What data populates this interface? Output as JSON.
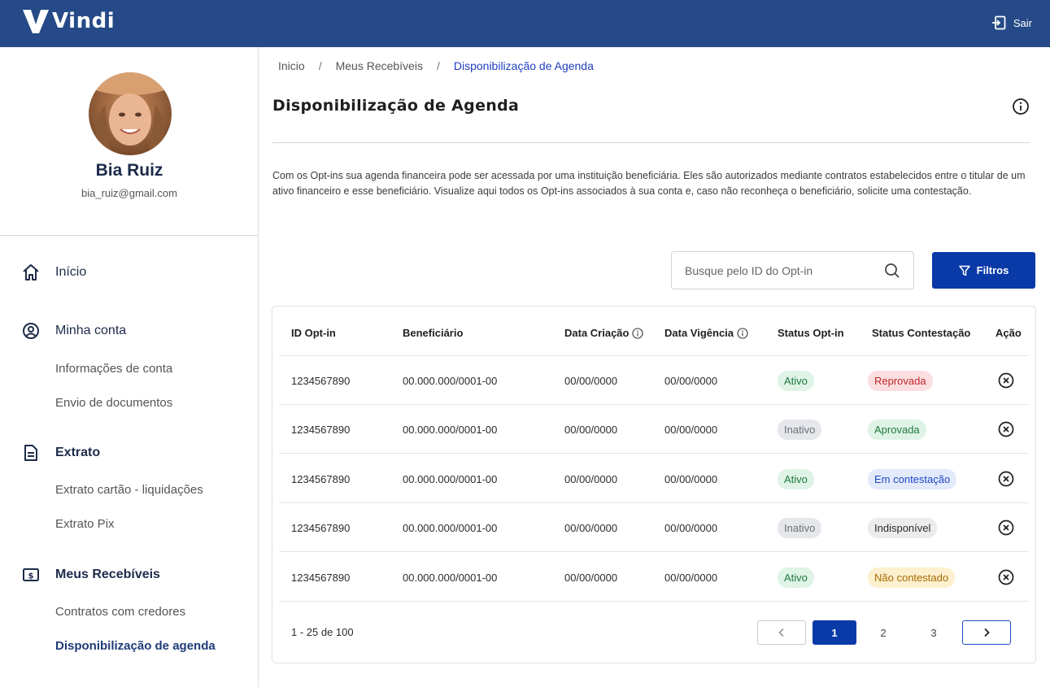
{
  "app": {
    "brand": "Vindi",
    "logout_label": "Sair"
  },
  "user": {
    "name": "Bia Ruiz",
    "email": "bia_ruiz@gmail.com"
  },
  "sidebar": {
    "groups": [
      {
        "label": "Início",
        "icon": "home-icon",
        "items": []
      },
      {
        "label": "Minha conta",
        "icon": "user-circle-icon",
        "items": [
          "Informações de conta",
          "Envio de documentos"
        ]
      },
      {
        "label": "Extrato",
        "icon": "document-icon",
        "items": [
          "Extrato cartão - liquidações",
          "Extrato Pix"
        ]
      },
      {
        "label": "Meus Recebíveis",
        "icon": "money-icon",
        "items": [
          "Contratos com credores",
          "Disponibilização de agenda"
        ]
      }
    ],
    "active_item": "Disponibilização de agenda"
  },
  "breadcrumb": [
    "Inicio",
    "Meus Recebíveis",
    "Disponibilização de Agenda"
  ],
  "breadcrumb_separator": "/",
  "page": {
    "title": "Disponibilização de Agenda",
    "description": "Com os Opt-ins sua agenda financeira pode ser acessada por uma instituição beneficiária. Eles são autorizados mediante contratos estabelecidos entre o titular de um ativo financeiro e esse beneficiário. Visualize aqui todos os Opt-ins associados à sua conta e, caso não reconheça o beneficiário, solicite uma contestação."
  },
  "search": {
    "placeholder": "Busque pelo ID do Opt-in",
    "value": ""
  },
  "filter_button": "Filtros",
  "table": {
    "headers": [
      "ID Opt-in",
      "Beneficiário",
      "Data Criação",
      "Data Vigência",
      "Status Opt-in",
      "Status Contestação",
      "Ação"
    ],
    "rows": [
      {
        "id": "1234567890",
        "beneficiario": "00.000.000/0001-00",
        "criacao": "00/00/0000",
        "vigencia": "00/00/0000",
        "status_optin": "Ativo",
        "status_contestacao": "Reprovada"
      },
      {
        "id": "1234567890",
        "beneficiario": "00.000.000/0001-00",
        "criacao": "00/00/0000",
        "vigencia": "00/00/0000",
        "status_optin": "Inativo",
        "status_contestacao": "Aprovada"
      },
      {
        "id": "1234567890",
        "beneficiario": "00.000.000/0001-00",
        "criacao": "00/00/0000",
        "vigencia": "00/00/0000",
        "status_optin": "Ativo",
        "status_contestacao": "Em contestação"
      },
      {
        "id": "1234567890",
        "beneficiario": "00.000.000/0001-00",
        "criacao": "00/00/0000",
        "vigencia": "00/00/0000",
        "status_optin": "Inativo",
        "status_contestacao": "Indisponível"
      },
      {
        "id": "1234567890",
        "beneficiario": "00.000.000/0001-00",
        "criacao": "00/00/0000",
        "vigencia": "00/00/0000",
        "status_optin": "Ativo",
        "status_contestacao": "Não contestado"
      }
    ]
  },
  "pagination": {
    "range": "1 - 25 de 100",
    "pages": [
      "1",
      "2",
      "3"
    ],
    "current": "1"
  },
  "colors": {
    "topbar": "#254a87",
    "primary": "#0a3aa8",
    "nav_text": "#1d2b4a"
  }
}
